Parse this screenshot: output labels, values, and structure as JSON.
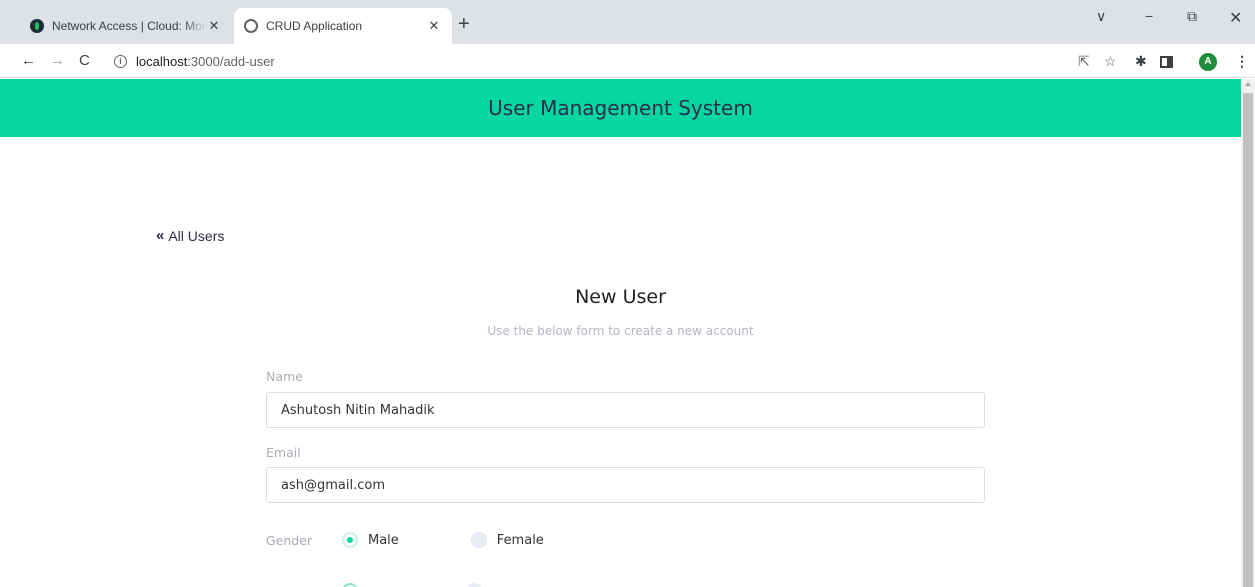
{
  "browser": {
    "tabs": [
      {
        "title": "Network Access | Cloud: MongoDB Cloud",
        "favicon": "mongodb-leaf-icon",
        "active": false
      },
      {
        "title": "CRUD Application",
        "favicon": "globe-icon",
        "active": true
      }
    ],
    "new_tab": "+",
    "url_host": "localhost",
    "url_path": ":3000/add-user",
    "profile_initial": "A",
    "window_controls": {
      "dropdown": "∨",
      "minimize": "−",
      "restore": "⧉",
      "close": "✕"
    }
  },
  "header": {
    "title": "User Management System",
    "color": "#06d6a0"
  },
  "nav": {
    "back_label": "All Users",
    "back_icon": "«"
  },
  "form": {
    "title": "New User",
    "subtitle": "Use the below form to create a new account",
    "name_label": "Name",
    "name_value": "Ashutosh Nitin Mahadik",
    "email_label": "Email",
    "email_value": "ash@gmail.com",
    "gender_label": "Gender",
    "gender_options": [
      "Male",
      "Female"
    ],
    "gender_selected": "Male",
    "accent_color": "#06d6a0"
  }
}
